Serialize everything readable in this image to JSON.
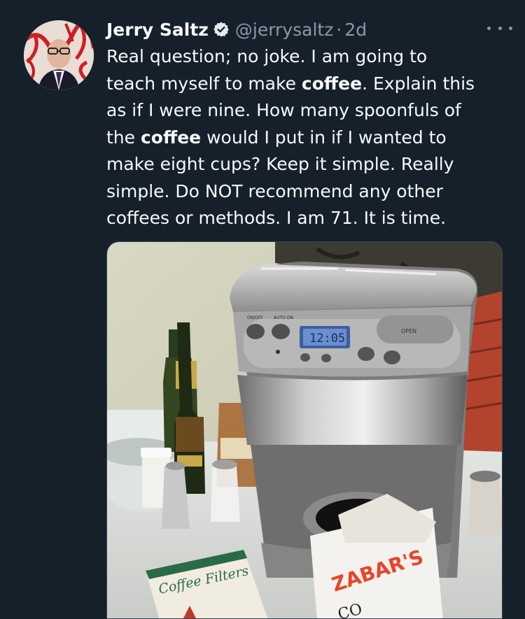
{
  "tweet": {
    "author_name": "Jerry Saltz",
    "handle": "@jerrysaltz",
    "separator": "·",
    "time": "2d",
    "text_lines": [
      [
        {
          "t": "Real question; no joke. I am going to"
        }
      ],
      [
        {
          "t": "teach myself to make "
        },
        {
          "t": "coffee",
          "b": true
        },
        {
          "t": ".  Explain this"
        }
      ],
      [
        {
          "t": "as if I were nine.  How many spoonfuls of"
        }
      ],
      [
        {
          "t": "the "
        },
        {
          "t": "coffee",
          "b": true
        },
        {
          "t": " would I put in if I wanted to"
        }
      ],
      [
        {
          "t": "make eight cups?  Keep it simple. Really"
        }
      ],
      [
        {
          "t": "simple. Do NOT recommend any other"
        }
      ],
      [
        {
          "t": "coffees or methods. I am 71. It is time."
        }
      ]
    ]
  },
  "photo": {
    "machine_labels": {
      "on_off": "ON/OFF",
      "auto_on": "AUTO ON",
      "open": "OPEN",
      "clock": "12:05"
    },
    "filters_label": "Coffee Filters",
    "bag_brand": "ZABAR'S",
    "bag_word": "CO"
  },
  "colors": {
    "background": "#15202b",
    "text": "#f7f9f9",
    "muted": "#8b98a5",
    "verified": "#e7e9ea"
  }
}
